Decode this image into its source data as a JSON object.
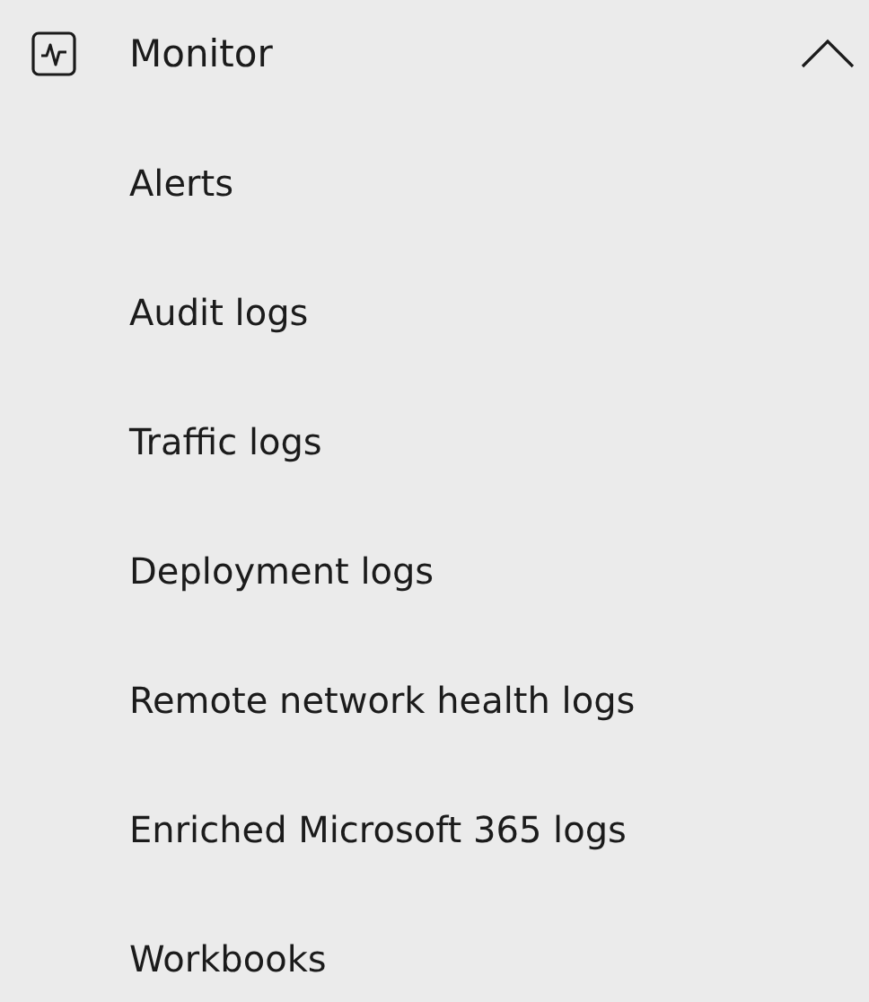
{
  "section": {
    "title": "Monitor",
    "expanded": true
  },
  "items": [
    {
      "label": "Alerts"
    },
    {
      "label": "Audit logs"
    },
    {
      "label": "Traffic logs"
    },
    {
      "label": "Deployment logs"
    },
    {
      "label": "Remote network health logs"
    },
    {
      "label": "Enriched Microsoft 365 logs"
    },
    {
      "label": "Workbooks"
    }
  ]
}
